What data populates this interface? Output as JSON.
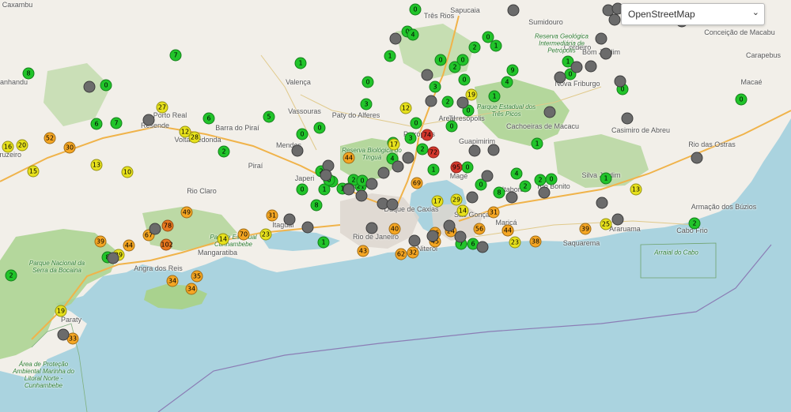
{
  "map_layer": {
    "selected": "OpenStreetMap",
    "options": [
      "OpenStreetMap"
    ]
  },
  "colors": {
    "sea": "#aad3df",
    "land": "#f2efe9",
    "forest": "#a9d28e",
    "grey": "#6b6b6b",
    "green": "#21c42a",
    "yellow": "#e7e11c",
    "orange": "#f5a623",
    "dark_orange": "#e8771e",
    "red": "#d4372c"
  },
  "places": [
    {
      "name": "Caxambu"
    },
    {
      "name": "Itanhandu"
    },
    {
      "name": "Sapucaia"
    },
    {
      "name": "Sumidouro"
    },
    {
      "name": "Cordeiro"
    },
    {
      "name": "Conceição de Macabu"
    },
    {
      "name": "Carapebus"
    },
    {
      "name": "Macaé"
    },
    {
      "name": "Valença"
    },
    {
      "name": "Porto Real"
    },
    {
      "name": "Resende"
    },
    {
      "name": "Volta Redonda"
    },
    {
      "name": "Barra do Piraí"
    },
    {
      "name": "Vassouras"
    },
    {
      "name": "Paty do Alferes"
    },
    {
      "name": "Petrópolis"
    },
    {
      "name": "Teresópolis"
    },
    {
      "name": "Mendes"
    },
    {
      "name": "Piraí"
    },
    {
      "name": "Rio Claro"
    },
    {
      "name": "Itaguaí"
    },
    {
      "name": "Mangaratiba"
    },
    {
      "name": "Angra dos Reis"
    },
    {
      "name": "Paraty"
    },
    {
      "name": "Rio de Janeiro"
    },
    {
      "name": "Duque de Caxias"
    },
    {
      "name": "Magé"
    },
    {
      "name": "São Gonçalo"
    },
    {
      "name": "Niterói"
    },
    {
      "name": "Maricá"
    },
    {
      "name": "Saquarema"
    },
    {
      "name": "Araruama"
    },
    {
      "name": "Cabo Frio"
    },
    {
      "name": "Armação dos Búzios"
    },
    {
      "name": "Rio das Ostras"
    },
    {
      "name": "Casimiro de Abreu"
    },
    {
      "name": "Silva Jardim"
    },
    {
      "name": "Rio Bonito"
    },
    {
      "name": "Itaboraí"
    },
    {
      "name": "Nova Friburgo"
    },
    {
      "name": "Bom Jardim"
    },
    {
      "name": "Guapimirim"
    },
    {
      "name": "Japeri"
    },
    {
      "name": "Cruzeiro"
    },
    {
      "name": "Três Rios"
    },
    {
      "name": "Areal"
    },
    {
      "name": "Cachoeiras de Macacu"
    }
  ],
  "feature_labels": [
    {
      "text": "Parque Nacional da Serra da Bocaina"
    },
    {
      "text": "Área de Proteção Ambiental Marinha do Litoral Norte - Cunhambebe"
    },
    {
      "text": "Reserva Biológica do Tinguá"
    },
    {
      "text": "Parque Estadual dos Três Picos"
    },
    {
      "text": "Parque Estadual Cunhambebe"
    },
    {
      "text": "Reserva Geológica Intermediária de Petrópolis"
    },
    {
      "text": "Arraial do Cabo"
    }
  ],
  "markers": [
    {
      "color": "green",
      "value": "0"
    },
    {
      "color": "green",
      "value": "0"
    },
    {
      "color": "green",
      "value": "2"
    },
    {
      "color": "green",
      "value": "0"
    },
    {
      "color": "green",
      "value": "1"
    },
    {
      "color": "green",
      "value": "7"
    },
    {
      "color": "green",
      "value": "8"
    },
    {
      "color": "green",
      "value": "0"
    },
    {
      "color": "green",
      "value": "0"
    },
    {
      "color": "green",
      "value": "3"
    },
    {
      "color": "green",
      "value": "2"
    },
    {
      "color": "green",
      "value": "3"
    },
    {
      "color": "green",
      "value": "9"
    },
    {
      "color": "green",
      "value": "1"
    },
    {
      "color": "green",
      "value": "0"
    },
    {
      "color": "green",
      "value": "1"
    },
    {
      "color": "green",
      "value": "0"
    },
    {
      "color": "green",
      "value": "6"
    },
    {
      "color": "green",
      "value": "7"
    },
    {
      "color": "green",
      "value": "6"
    },
    {
      "color": "green",
      "value": "5"
    },
    {
      "color": "green",
      "value": "0"
    },
    {
      "color": "green",
      "value": "0"
    },
    {
      "color": "green",
      "value": "2"
    },
    {
      "color": "green",
      "value": "2"
    },
    {
      "color": "green",
      "value": "0"
    },
    {
      "color": "green",
      "value": "8"
    },
    {
      "color": "green",
      "value": "2"
    },
    {
      "color": "green",
      "value": "1"
    },
    {
      "color": "green",
      "value": "21"
    },
    {
      "color": "green",
      "value": "1"
    },
    {
      "color": "green",
      "value": "0"
    },
    {
      "color": "green",
      "value": "4"
    },
    {
      "color": "green",
      "value": "0"
    },
    {
      "color": "green",
      "value": "8"
    },
    {
      "color": "green",
      "value": "2"
    },
    {
      "color": "green",
      "value": "0"
    },
    {
      "color": "green",
      "value": "2"
    },
    {
      "color": "green",
      "value": "1"
    },
    {
      "color": "green",
      "value": "4"
    },
    {
      "color": "green",
      "value": "0"
    },
    {
      "color": "green",
      "value": "3"
    },
    {
      "color": "green",
      "value": "2"
    },
    {
      "color": "green",
      "value": "0"
    },
    {
      "color": "green",
      "value": "1"
    },
    {
      "color": "green",
      "value": "0"
    },
    {
      "color": "green",
      "value": "0"
    },
    {
      "color": "green",
      "value": "4"
    },
    {
      "color": "green",
      "value": "2"
    },
    {
      "color": "green",
      "value": "0"
    },
    {
      "color": "green",
      "value": "1"
    },
    {
      "color": "green",
      "value": "0"
    },
    {
      "color": "green",
      "value": "2"
    },
    {
      "color": "green",
      "value": "0"
    },
    {
      "color": "green",
      "value": "4"
    },
    {
      "color": "green",
      "value": "1"
    },
    {
      "color": "green",
      "value": "0"
    },
    {
      "color": "green",
      "value": "6"
    },
    {
      "color": "green",
      "value": "7"
    },
    {
      "color": "green",
      "value": "2"
    },
    {
      "color": "green",
      "value": "0"
    },
    {
      "color": "green",
      "value": "1"
    },
    {
      "color": "green",
      "value": "0"
    },
    {
      "color": "green",
      "value": "1"
    },
    {
      "color": "green",
      "value": "0"
    },
    {
      "color": "green",
      "value": "2"
    },
    {
      "color": "green",
      "value": "8"
    },
    {
      "color": "yellow",
      "value": "16"
    },
    {
      "color": "yellow",
      "value": "20"
    },
    {
      "color": "yellow",
      "value": "15"
    },
    {
      "color": "yellow",
      "value": "13"
    },
    {
      "color": "yellow",
      "value": "10"
    },
    {
      "color": "yellow",
      "value": "12"
    },
    {
      "color": "yellow",
      "value": "28"
    },
    {
      "color": "yellow",
      "value": "27"
    },
    {
      "color": "yellow",
      "value": "12"
    },
    {
      "color": "yellow",
      "value": "17"
    },
    {
      "color": "yellow",
      "value": "14"
    },
    {
      "color": "yellow",
      "value": "23"
    },
    {
      "color": "yellow",
      "value": "29"
    },
    {
      "color": "yellow",
      "value": "19"
    },
    {
      "color": "yellow",
      "value": "23"
    },
    {
      "color": "yellow",
      "value": "25"
    },
    {
      "color": "yellow",
      "value": "17"
    },
    {
      "color": "yellow",
      "value": "29"
    },
    {
      "color": "yellow",
      "value": "19"
    },
    {
      "color": "yellow",
      "value": "14"
    },
    {
      "color": "yellow",
      "value": "13"
    },
    {
      "color": "orange",
      "value": "52"
    },
    {
      "color": "orange",
      "value": "30"
    },
    {
      "color": "orange",
      "value": "49"
    },
    {
      "color": "orange",
      "value": "39"
    },
    {
      "color": "orange",
      "value": "44"
    },
    {
      "color": "orange",
      "value": "34"
    },
    {
      "color": "orange",
      "value": "34"
    },
    {
      "color": "orange",
      "value": "70"
    },
    {
      "color": "orange",
      "value": "31"
    },
    {
      "color": "orange",
      "value": "43"
    },
    {
      "color": "orange",
      "value": "69"
    },
    {
      "color": "orange",
      "value": "44"
    },
    {
      "color": "orange",
      "value": "31"
    },
    {
      "color": "orange",
      "value": "44"
    },
    {
      "color": "orange",
      "value": "39"
    },
    {
      "color": "orange",
      "value": "38"
    },
    {
      "color": "orange",
      "value": "56"
    },
    {
      "color": "orange",
      "value": "44"
    },
    {
      "color": "orange",
      "value": "33"
    },
    {
      "color": "orange",
      "value": "35"
    },
    {
      "color": "orange",
      "value": "32"
    },
    {
      "color": "orange",
      "value": "36"
    },
    {
      "color": "orange",
      "value": "45"
    },
    {
      "color": "orange",
      "value": "62"
    },
    {
      "color": "orange",
      "value": "67"
    },
    {
      "color": "orange",
      "value": "24"
    },
    {
      "color": "orange",
      "value": "40"
    },
    {
      "color": "dark_orange",
      "value": "102"
    },
    {
      "color": "dark_orange",
      "value": "78"
    },
    {
      "color": "red",
      "value": "72"
    },
    {
      "color": "red",
      "value": "74"
    },
    {
      "color": "red",
      "value": "95"
    }
  ]
}
